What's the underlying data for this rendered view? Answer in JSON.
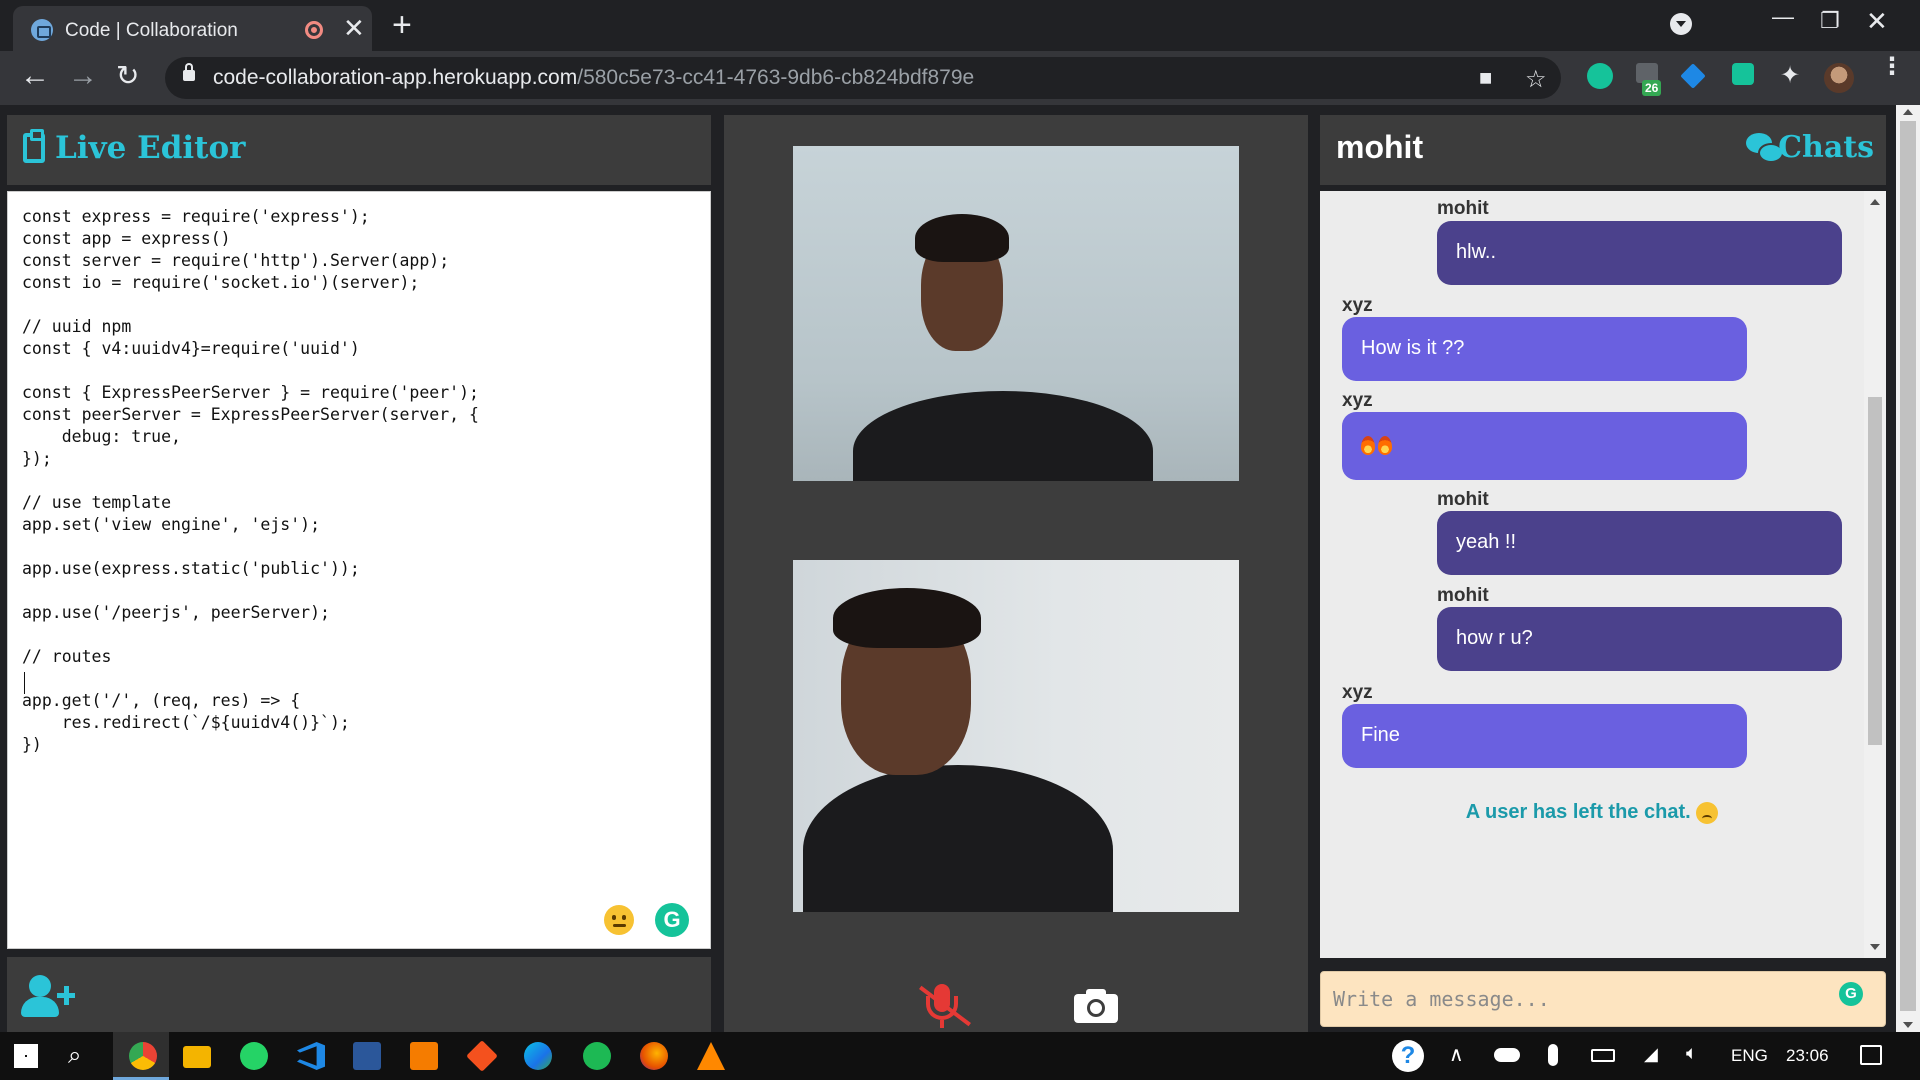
{
  "browser": {
    "tab_title": "Code | Collaboration",
    "tab_close": "✕",
    "new_tab": "+",
    "url_host": "code-collaboration-app.herokuapp.com",
    "url_path": "/580c5e73-cc41-4763-9db6-cb824bdf879e",
    "extension_badge": "26"
  },
  "editor": {
    "title": "Live Editor",
    "code": "const express = require('express');\nconst app = express()\nconst server = require('http').Server(app);\nconst io = require('socket.io')(server);\n\n// uuid npm\nconst { v4:uuidv4}=require('uuid')\n\nconst { ExpressPeerServer } = require('peer');\nconst peerServer = ExpressPeerServer(server, {\n    debug: true,\n});\n\n// use template\napp.set('view engine', 'ejs');\n\napp.use(express.static('public'));\n\napp.use('/peerjs', peerServer);\n\n// routes\n\napp.get('/', (req, res) => {\n    res.redirect(`/${uuidv4()}`);\n})"
  },
  "chat": {
    "user": "mohit",
    "title": "Chats",
    "messages": [
      {
        "sender": "mohit",
        "text": "hlw..",
        "self": true
      },
      {
        "sender": "xyz",
        "text": "How is it ??",
        "self": false
      },
      {
        "sender": "xyz",
        "text": "",
        "self": false
      },
      {
        "sender": "mohit",
        "text": "yeah !!",
        "self": true
      },
      {
        "sender": "mohit",
        "text": "how r u?",
        "self": true
      },
      {
        "sender": "xyz",
        "text": "Fine",
        "self": false
      }
    ],
    "system_message": "A user has left the chat.",
    "input_placeholder": "Write a message..."
  },
  "taskbar": {
    "language": "ENG",
    "time": "23:06"
  },
  "colors": {
    "accent": "#2bc4d8",
    "self_bubble": "#4b418c",
    "other_bubble": "#6a60e0",
    "mic_muted": "#e53935"
  }
}
